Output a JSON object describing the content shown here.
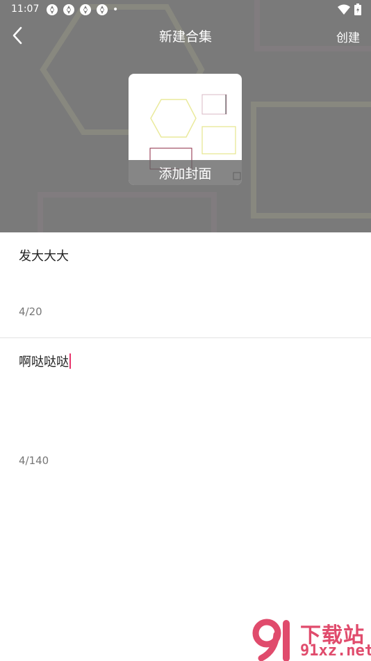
{
  "status_bar": {
    "time": "11:07",
    "app_icons": [
      "app-icon",
      "app-icon",
      "app-icon",
      "app-icon"
    ],
    "dot": "•"
  },
  "title_bar": {
    "title": "新建合集",
    "action": "创建"
  },
  "cover": {
    "label": "添加封面"
  },
  "form": {
    "title_value": "发大大大",
    "title_counter": "4/20",
    "desc_value": "啊哒哒哒",
    "desc_counter": "4/140"
  },
  "watermark": {
    "brand_cn": "下载站",
    "url": "91xz.net"
  },
  "colors": {
    "header_bg": "#7a7a7a",
    "caret": "#e8336b",
    "watermark": "#e04b6c"
  }
}
